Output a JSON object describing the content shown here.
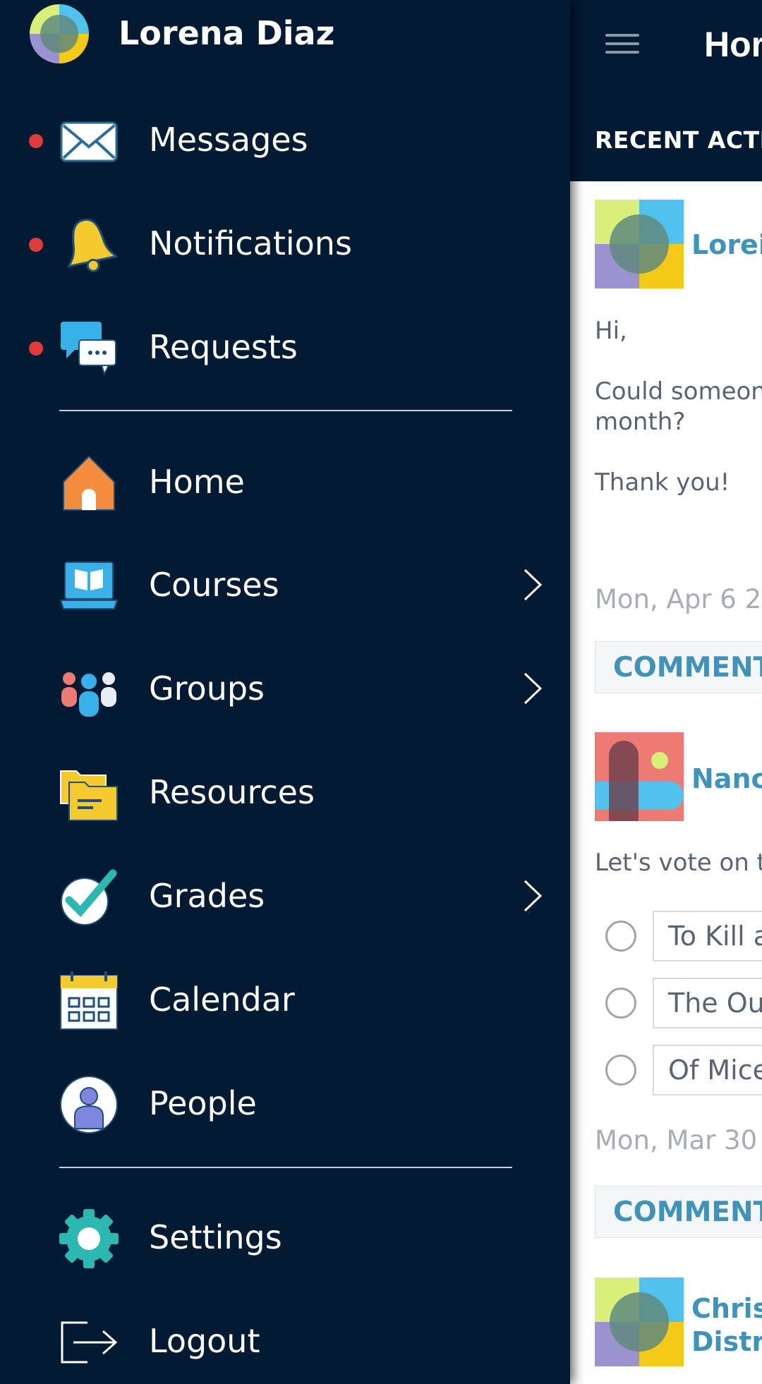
{
  "drawer": {
    "user_name": "Lorena Diaz",
    "items_top": [
      {
        "label": "Messages",
        "icon": "envelope-icon",
        "unread": true
      },
      {
        "label": "Notifications",
        "icon": "bell-icon",
        "unread": true
      },
      {
        "label": "Requests",
        "icon": "chat-bubbles-icon",
        "unread": true
      }
    ],
    "items_main": [
      {
        "label": "Home",
        "icon": "house-icon"
      },
      {
        "label": "Courses",
        "icon": "laptop-book-icon",
        "has_submenu": true
      },
      {
        "label": "Groups",
        "icon": "people-group-icon",
        "has_submenu": true
      },
      {
        "label": "Resources",
        "icon": "folders-icon"
      },
      {
        "label": "Grades",
        "icon": "checkmark-icon",
        "has_submenu": true
      },
      {
        "label": "Calendar",
        "icon": "calendar-icon"
      },
      {
        "label": "People",
        "icon": "person-icon"
      }
    ],
    "items_bottom": [
      {
        "label": "Settings",
        "icon": "gear-icon"
      },
      {
        "label": "Logout",
        "icon": "logout-icon"
      }
    ]
  },
  "main": {
    "title": "Hor",
    "section_title": "RECENT ACTIV",
    "posts": [
      {
        "author": "Lorei",
        "lines": [
          "Hi,",
          "Could someon",
          "month?",
          "Thank you!"
        ],
        "date": "Mon, Apr 6 2",
        "comment_label": "COMMENT"
      },
      {
        "author": "Nanc",
        "text": "Let's vote on th",
        "poll_options": [
          "To Kill a",
          "The Ou",
          "Of Mice"
        ],
        "date": "Mon, Mar 30",
        "comment_label": "COMMENT"
      },
      {
        "author_lines": [
          "Chris",
          "Distr"
        ]
      }
    ]
  },
  "colors": {
    "navy": "#021b33",
    "accent_blue": "#3f93b8",
    "unread_dot": "#e03a3a"
  }
}
